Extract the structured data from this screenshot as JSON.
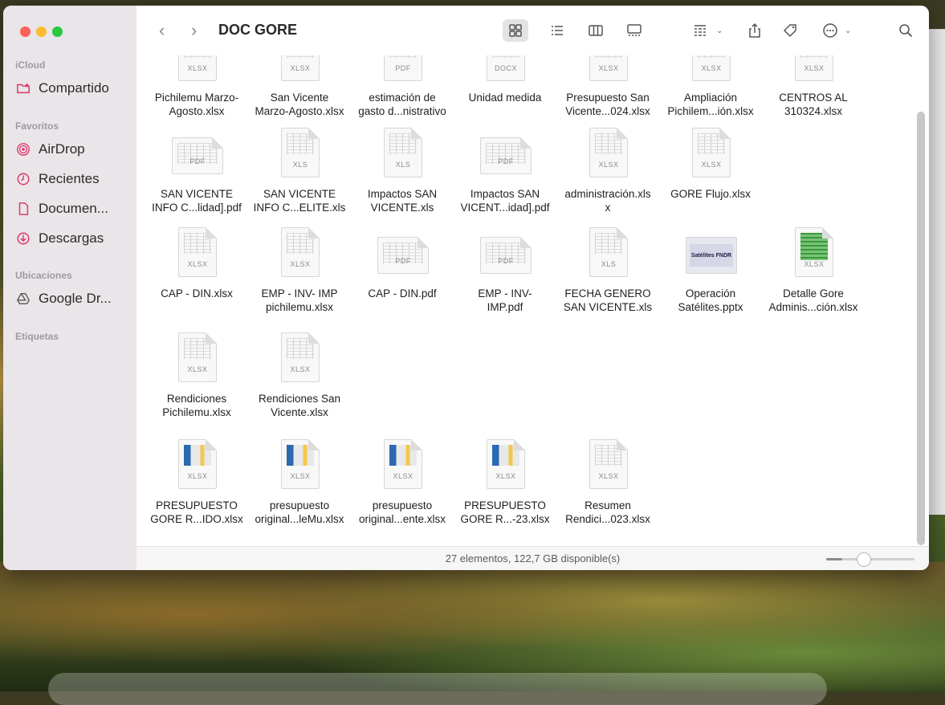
{
  "window": {
    "title": "DOC GORE",
    "status": "27 elementos, 122,7 GB disponible(s)"
  },
  "sidebar": {
    "sections": {
      "icloud": "iCloud",
      "favoritos": "Favoritos",
      "ubicaciones": "Ubicaciones",
      "etiquetas": "Etiquetas"
    },
    "items": [
      {
        "label": "Compartido",
        "icon": "shared-folder-icon"
      },
      {
        "label": "AirDrop",
        "icon": "airdrop-icon"
      },
      {
        "label": "Recientes",
        "icon": "clock-icon"
      },
      {
        "label": "Documen...",
        "icon": "document-icon"
      },
      {
        "label": "Descargas",
        "icon": "download-icon"
      },
      {
        "label": "Google Dr...",
        "icon": "google-drive-icon"
      }
    ]
  },
  "toolbar": {
    "back": "‹",
    "forward": "›"
  },
  "files": [
    {
      "name": "Pichilemu Marzo-Agosto.xlsx",
      "line1": "Pichilemu Marzo-",
      "line2": "Agosto.xlsx",
      "type": "XLSX"
    },
    {
      "name": "San Vicente Marzo-Agosto.xlsx",
      "line1": "San Vicente",
      "line2": "Marzo-Agosto.xlsx",
      "type": "XLSX"
    },
    {
      "name": "estimación de gasto d...nistrativo",
      "line1": "estimación de",
      "line2": "gasto d...nistrativo",
      "type": "PDF"
    },
    {
      "name": "Unidad medida",
      "line1": "Unidad medida",
      "line2": "",
      "type": "DOCX"
    },
    {
      "name": "Presupuesto San Vicente...024.xlsx",
      "line1": "Presupuesto San",
      "line2": "Vicente...024.xlsx",
      "type": "XLSX"
    },
    {
      "name": "Ampliación Pichilem...ión.xlsx",
      "line1": "Ampliación",
      "line2": "Pichilem...ión.xlsx",
      "type": "XLSX"
    },
    {
      "name": "CENTROS AL 310324.xlsx",
      "line1": "CENTROS AL",
      "line2": "310324.xlsx",
      "type": "XLSX"
    },
    {
      "name": "SAN VICENTE INFO C...lidad].pdf",
      "line1": "SAN VICENTE",
      "line2": "INFO C...lidad].pdf",
      "type": "PDF"
    },
    {
      "name": "SAN VICENTE INFO C...ELITE.xls",
      "line1": "SAN VICENTE",
      "line2": "INFO C...ELITE.xls",
      "type": "XLS"
    },
    {
      "name": "Impactos SAN VICENTE.xls",
      "line1": "Impactos SAN",
      "line2": "VICENTE.xls",
      "type": "XLS"
    },
    {
      "name": "Impactos SAN VICENT...idad].pdf",
      "line1": "Impactos SAN",
      "line2": "VICENT...idad].pdf",
      "type": "PDF"
    },
    {
      "name": "administración.xlsx",
      "line1": "administración.xls",
      "line2": "x",
      "type": "XLSX"
    },
    {
      "name": "GORE Flujo.xlsx",
      "line1": "GORE Flujo.xlsx",
      "line2": "",
      "type": "XLSX"
    },
    {
      "name": "CAP - DIN.xlsx",
      "line1": "CAP - DIN.xlsx",
      "line2": "",
      "type": "XLSX"
    },
    {
      "name": "EMP - INV- IMP pichilemu.xlsx",
      "line1": "EMP - INV- IMP",
      "line2": "pichilemu.xlsx",
      "type": "XLSX"
    },
    {
      "name": "CAP - DIN.pdf",
      "line1": "CAP - DIN.pdf",
      "line2": "",
      "type": "PDF"
    },
    {
      "name": "EMP - INV- IMP.pdf",
      "line1": "EMP - INV-",
      "line2": "IMP.pdf",
      "type": "PDF"
    },
    {
      "name": "FECHA GENERO SAN VICENTE.xls",
      "line1": "FECHA GENERO",
      "line2": "SAN VICENTE.xls",
      "type": "XLS"
    },
    {
      "name": "Operación Satélites.pptx",
      "line1": "Operación",
      "line2": "Satélites.pptx",
      "type": "PPTX",
      "slide_text": "Satélites FNDR"
    },
    {
      "name": "Detalle Gore Adminis...ción.xlsx",
      "line1": "Detalle Gore",
      "line2": "Adminis...ción.xlsx",
      "type": "XLSX"
    },
    {
      "name": "Rendiciones Pichilemu.xlsx",
      "line1": "Rendiciones",
      "line2": "Pichilemu.xlsx",
      "type": "XLSX"
    },
    {
      "name": "Rendiciones San Vicente.xlsx",
      "line1": "Rendiciones San",
      "line2": "Vicente.xlsx",
      "type": "XLSX"
    },
    {
      "name": "PRESUPUESTO GORE R...IDO.xlsx",
      "line1": "PRESUPUESTO",
      "line2": "GORE R...IDO.xlsx",
      "type": "XLSX"
    },
    {
      "name": "presupuesto original...leMu.xlsx",
      "line1": "presupuesto",
      "line2": "original...leMu.xlsx",
      "type": "XLSX"
    },
    {
      "name": "presupuesto original...ente.xlsx",
      "line1": "presupuesto",
      "line2": "original...ente.xlsx",
      "type": "XLSX"
    },
    {
      "name": "PRESUPUESTO GORE R...-23.xlsx",
      "line1": "PRESUPUESTO",
      "line2": "GORE R...-23.xlsx",
      "type": "XLSX"
    },
    {
      "name": "Resumen Rendici...023.xlsx",
      "line1": "Resumen",
      "line2": "Rendici...023.xlsx",
      "type": "XLSX"
    }
  ]
}
